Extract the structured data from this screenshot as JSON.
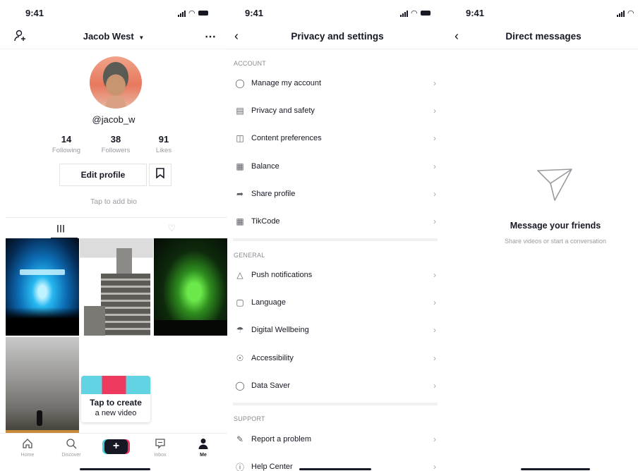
{
  "status_time": "9:41",
  "profile": {
    "username": "Jacob West",
    "handle": "@jacob_w",
    "stats": [
      {
        "value": "14",
        "label": "Following"
      },
      {
        "value": "38",
        "label": "Followers"
      },
      {
        "value": "91",
        "label": "Likes"
      }
    ],
    "edit_label": "Edit profile",
    "bio_placeholder": "Tap to add bio",
    "tooltip_line1": "Tap to create",
    "tooltip_line2": "a new video",
    "tabbar": [
      {
        "label": "Home",
        "icon": "home-icon"
      },
      {
        "label": "Discover",
        "icon": "search-icon"
      },
      {
        "label": "Inbox",
        "icon": "inbox-icon"
      },
      {
        "label": "Me",
        "icon": "person-icon"
      }
    ]
  },
  "settings": {
    "title": "Privacy and settings",
    "sections": [
      {
        "heading": "ACCOUNT",
        "items": [
          {
            "label": "Manage my account",
            "icon": "person-icon"
          },
          {
            "label": "Privacy and safety",
            "icon": "lock-icon"
          },
          {
            "label": "Content preferences",
            "icon": "video-icon"
          },
          {
            "label": "Balance",
            "icon": "wallet-icon"
          },
          {
            "label": "Share profile",
            "icon": "share-icon"
          },
          {
            "label": "TikCode",
            "icon": "qr-icon"
          }
        ]
      },
      {
        "heading": "GENERAL",
        "items": [
          {
            "label": "Push notifications",
            "icon": "bell-icon"
          },
          {
            "label": "Language",
            "icon": "language-icon"
          },
          {
            "label": "Digital Wellbeing",
            "icon": "umbrella-icon"
          },
          {
            "label": "Accessibility",
            "icon": "accessibility-icon"
          },
          {
            "label": "Data Saver",
            "icon": "data-saver-icon"
          }
        ]
      },
      {
        "heading": "SUPPORT",
        "items": [
          {
            "label": "Report a problem",
            "icon": "pencil-icon"
          },
          {
            "label": "Help Center",
            "icon": "help-icon"
          }
        ]
      }
    ]
  },
  "messages": {
    "title": "Direct messages",
    "empty_title": "Message your friends",
    "empty_subtitle": "Share videos or start a conversation"
  }
}
